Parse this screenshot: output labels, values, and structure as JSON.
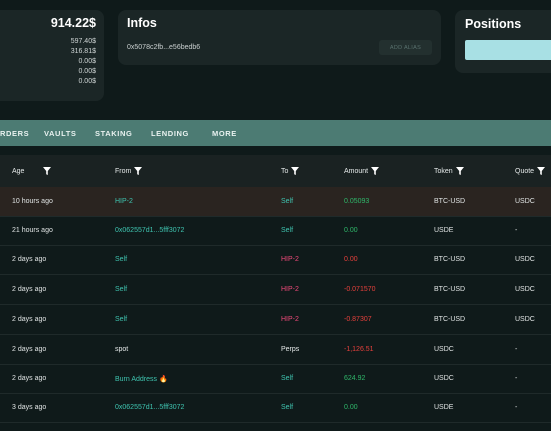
{
  "balance": {
    "total": "914.22$",
    "lines": [
      "597.40$",
      "316.81$",
      "0.00$",
      "0.00$",
      "0.00$"
    ]
  },
  "infos": {
    "title": "Infos",
    "address": "0x5078c2fb...e56bedb6",
    "add_alias_label": "ADD ALIAS"
  },
  "positions": {
    "title": "Positions"
  },
  "nav": {
    "items": [
      "RDERS",
      "VAULTS",
      "STAKING",
      "LENDING",
      "MORE"
    ]
  },
  "table": {
    "headers": {
      "age": "Age",
      "from": "From",
      "to": "To",
      "amount": "Amount",
      "token": "Token",
      "quote": "Quote"
    },
    "rows": [
      {
        "age": "10 hours ago",
        "from": "HIP-2",
        "to": "Self",
        "amount": "0.05093",
        "token": "BTC-USD",
        "quote": "USDC"
      },
      {
        "age": "21 hours ago",
        "from": "0x062557d1...5fff3072",
        "to": "Self",
        "amount": "0.00",
        "token": "USDE",
        "quote": "-"
      },
      {
        "age": "2 days ago",
        "from": "Self",
        "to": "HIP-2",
        "amount": "0.00",
        "token": "BTC-USD",
        "quote": "USDC"
      },
      {
        "age": "2 days ago",
        "from": "Self",
        "to": "HIP-2",
        "amount": "-0.071570",
        "token": "BTC-USD",
        "quote": "USDC"
      },
      {
        "age": "2 days ago",
        "from": "Self",
        "to": "HIP-2",
        "amount": "-0.87307",
        "token": "BTC-USD",
        "quote": "USDC"
      },
      {
        "age": "2 days ago",
        "from": "spot",
        "to": "Perps",
        "amount": "-1,126.51",
        "token": "USDC",
        "quote": "-"
      },
      {
        "age": "2 days ago",
        "from": "Burn Address 🔥",
        "to": "Self",
        "amount": "624.92",
        "token": "USDC",
        "quote": "-"
      },
      {
        "age": "3 days ago",
        "from": "0x062557d1...5fff3072",
        "to": "Self",
        "amount": "0.00",
        "token": "USDE",
        "quote": "-"
      }
    ]
  },
  "colors": {
    "accent_teal": "#3fc4b0",
    "negative_red": "#e5403c",
    "positive_green": "#2fb76a",
    "nav_bg": "#4c7b73"
  },
  "icons": {
    "filter": "filter-icon"
  }
}
